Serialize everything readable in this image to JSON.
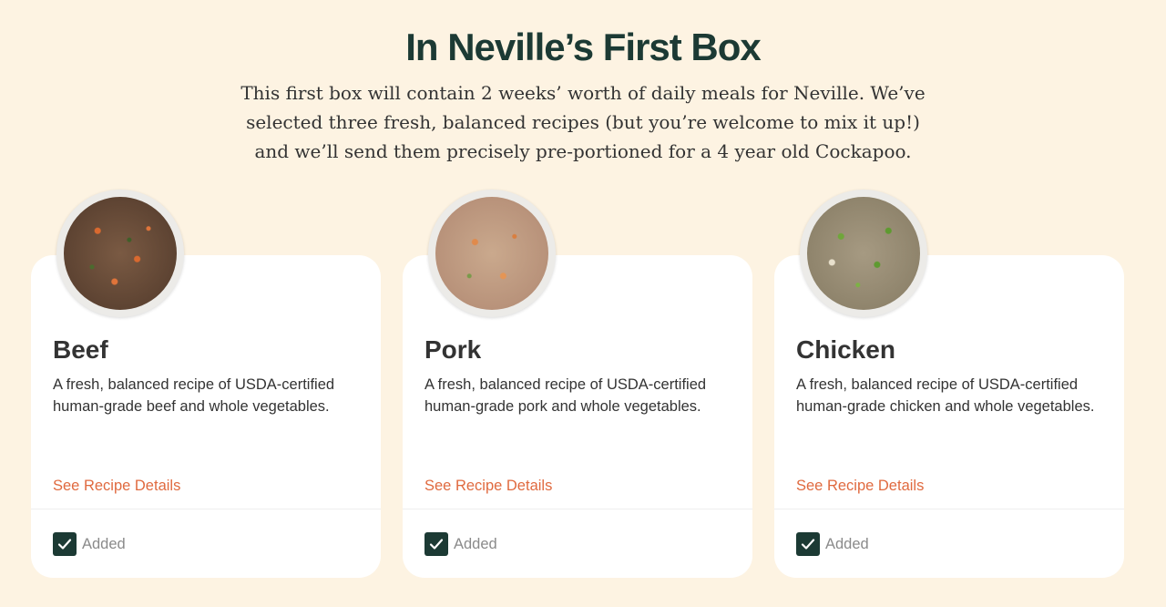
{
  "header": {
    "title": "In Neville’s First Box",
    "subtitle": "This first box will contain 2 weeks’ worth of daily meals for Neville. We’ve selected three fresh, balanced recipes (but you’re welcome to mix it up!) and we’ll send them precisely pre-portioned for a 4 year old Cockapoo."
  },
  "recipes": [
    {
      "name": "Beef",
      "description": "A fresh, balanced recipe of USDA-certified human-grade beef and whole vegetables.",
      "link": "See Recipe Details",
      "status": "Added",
      "checked": true
    },
    {
      "name": "Pork",
      "description": "A fresh, balanced recipe of USDA-certified human-grade pork and whole vegetables.",
      "link": "See Recipe Details",
      "status": "Added",
      "checked": true
    },
    {
      "name": "Chicken",
      "description": "A fresh, balanced recipe of USDA-certified human-grade chicken and whole vegetables.",
      "link": "See Recipe Details",
      "status": "Added",
      "checked": true
    }
  ],
  "colors": {
    "background": "#fdf3e2",
    "heading": "#1c3a34",
    "link": "#e06a3f",
    "checkbox": "#1c3a34"
  }
}
